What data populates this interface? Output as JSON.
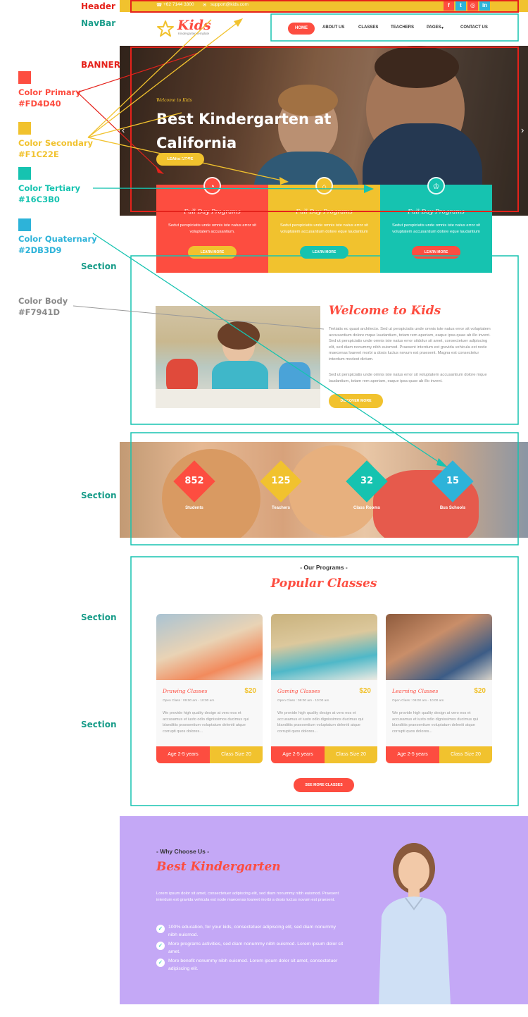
{
  "annotations": {
    "header_label": "Header",
    "navbar_label": "NavBar",
    "banner_label": "BANNER",
    "section_label": "Section",
    "colors": [
      {
        "name": "Color Primary",
        "hex": "#FD4D40",
        "swatch": "#fd4d40"
      },
      {
        "name": "Color Secondary",
        "hex": "#F1C22E",
        "swatch": "#f1c22e"
      },
      {
        "name": "Color Tertiary",
        "hex": "#16C3B0",
        "swatch": "#16c3b0"
      },
      {
        "name": "Color Quaternary",
        "hex": "#2DB3D9",
        "swatch": "#2db3d9"
      }
    ],
    "body_color": {
      "name": "Color Body",
      "hex": "#F7941D"
    }
  },
  "topbar": {
    "phone": "+62 7144 3300",
    "email": "support@kids.com",
    "social": [
      {
        "icon": "facebook-icon",
        "glyph": "f",
        "color": "#fd4d40"
      },
      {
        "icon": "twitter-icon",
        "glyph": "t",
        "color": "#2db3d9"
      },
      {
        "icon": "instagram-icon",
        "glyph": "◎",
        "color": "#fd4d40"
      },
      {
        "icon": "linkedin-icon",
        "glyph": "in",
        "color": "#2db3d9"
      }
    ]
  },
  "nav": {
    "logo": "Kids",
    "logo_sub": "Kindergarten template",
    "home": "HOME",
    "about": "ABOUT US",
    "classes": "CLASSES",
    "teachers": "TEACHERS",
    "pages": "PAGES",
    "contact": "CONTACT US"
  },
  "banner": {
    "kicker": "Welcome to Kids",
    "title_line1": "Best Kindergarten at",
    "title_line2": "California",
    "button": "LEARN MORE"
  },
  "features": [
    {
      "title": "Full Day Programs",
      "text": "Sedut perspiciatis unde omnis iste natus error sit voluptatem accusantium.",
      "button": "LEARN MORE",
      "bg": "#fd4d40",
      "btn": "#f1c22e",
      "icon": "gauge-icon",
      "glyph": "◔"
    },
    {
      "title": "Full Day Programs",
      "text": "Sedut perspiciatis unde omnis iste natus error sit voluptatem accusantium dolore eque laudantium",
      "button": "LEARN MORE",
      "bg": "#f1c22e",
      "btn": "#16c3b0",
      "icon": "home-icon",
      "glyph": "⌂"
    },
    {
      "title": "Full Day Programs",
      "text": "Sedut perspiciatis unde omnis iste natus error sit voluptatem accusantium dolore eque laudantium",
      "button": "LEARN MORE",
      "bg": "#16c3b0",
      "btn": "#fd4d40",
      "icon": "trophy-icon",
      "glyph": "♔"
    }
  ],
  "welcome": {
    "title": "Welcome to Kids",
    "p1": "Tertiatis ec quasi architecto. Sed ut perspiciatis unde omnis iste natus error sit voluptatem accusantium dolore mque laudantium, totam rem aperiam, eaque ipsa quae ab illo invent. Sed ut perspiciatis unde omnis iste natus error sitdolur sit amet, consectetuer adipiscing elit, sed diam nonummy nibh euismod. Praesent interdum est gravida vehicula est node maecenas loareet morbi a dosis luctus novum est praesent. Magna est consectetur interdum modest dictum.",
    "p2": "Sed ut perspiciatis unde omnis iste natus error sit voluptatem accusantium dolore mque laudantium, totam rem aperiam, eaque ipsa quae ab illo invent.",
    "button": "DISCOVER MORE"
  },
  "stats": [
    {
      "value": "852",
      "label": "Students",
      "color": "#fd4d40"
    },
    {
      "value": "125",
      "label": "Teachers",
      "color": "#f1c22e"
    },
    {
      "value": "32",
      "label": "Class Rooms",
      "color": "#16c3b0"
    },
    {
      "value": "15",
      "label": "Bus Schools",
      "color": "#2db3d9"
    }
  ],
  "programs": {
    "kicker": "- Our Programs -",
    "title": "Popular Classes",
    "cards": [
      {
        "name": "Drawing Classes",
        "price": "$20",
        "meta": "Open Class : 09:00 am - 10:00 am",
        "desc": "We provide high quality design at vero eos et accusamus et iusto odio dignissimos ducimus qui blanditiis praesentium voluptatum deleniti atque corrupti quos dolores...",
        "age": "Age 2-5 years",
        "size": "Class Size 20"
      },
      {
        "name": "Gaming Classes",
        "price": "$20",
        "meta": "Open Class : 09:00 am - 10:00 am",
        "desc": "We provide high quality design at vero eos et accusamus et iusto odio dignissimos ducimus qui blanditiis praesentium voluptatum deleniti atque corrupti quos dolores...",
        "age": "Age 2-5 years",
        "size": "Class Size 20"
      },
      {
        "name": "Learning Classes",
        "price": "$20",
        "meta": "Open Class : 09:00 am - 10:00 am",
        "desc": "We provide high quality design at vero eos et accusamus et iusto odio dignissimos ducimus qui blanditiis praesentium voluptatum deleniti atque corrupti quos dolores...",
        "age": "Age 2-5 years",
        "size": "Class Size 20"
      }
    ],
    "button": "SEE MORE CLASSES"
  },
  "why": {
    "kicker": "- Why Choose Us -",
    "title": "Best Kindergarten",
    "p": "Lorem ipsum dolor sit amet, consectetuer adipiscing elit, sed diam nonummy nibh euismod. Praesent interdum est gravida vehicula est node maecenas loareet morbi a dosis luctus novum est praesent.",
    "points": [
      "100% education, for your kids, consectetuer adipiscing elit, sed diam nonummy nibh euismod.",
      "More programs activities, sed diam nonummy nibh euismod. Lorem ipsum dolor sit amet.",
      "More benefit nonummy nibh euismod. Lorem ipsum dolor sit amet, consectetuer adipiscing elit."
    ]
  }
}
